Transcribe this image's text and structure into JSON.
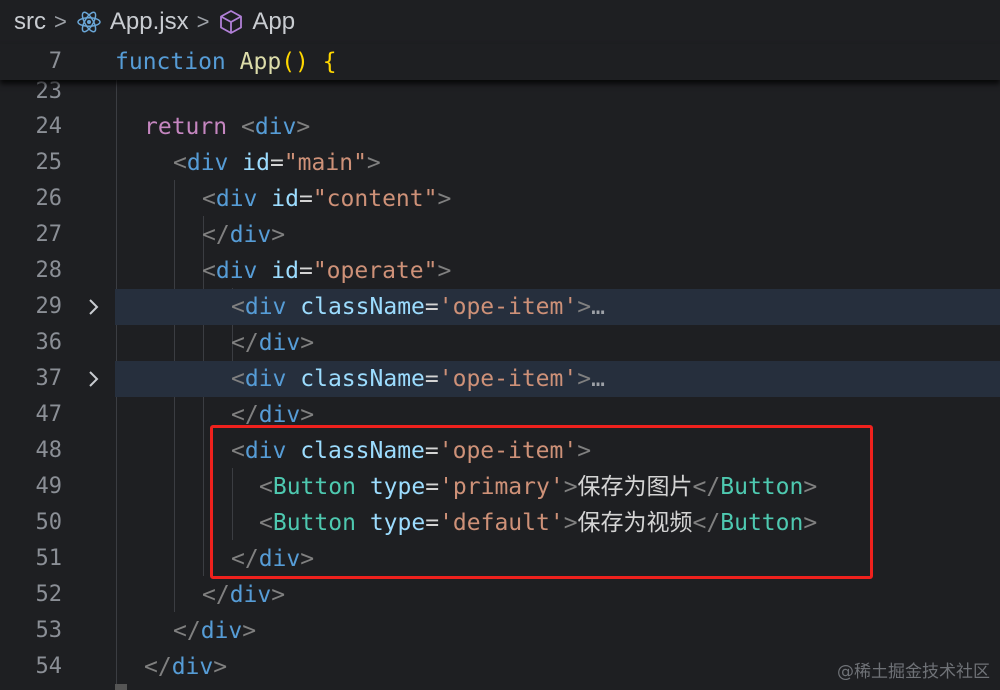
{
  "breadcrumb": {
    "folder": "src",
    "file": "App.jsx",
    "symbol": "App"
  },
  "sticky_line": {
    "number": "7",
    "keyword": "function",
    "name": "App",
    "parens": "()",
    "brace": "{"
  },
  "lines": [
    {
      "n": "23"
    },
    {
      "n": "24"
    },
    {
      "n": "25"
    },
    {
      "n": "26"
    },
    {
      "n": "27"
    },
    {
      "n": "28"
    },
    {
      "n": "29"
    },
    {
      "n": "36"
    },
    {
      "n": "37"
    },
    {
      "n": "47"
    },
    {
      "n": "48"
    },
    {
      "n": "49"
    },
    {
      "n": "50"
    },
    {
      "n": "51"
    },
    {
      "n": "52"
    },
    {
      "n": "53"
    },
    {
      "n": "54"
    }
  ],
  "code": {
    "return_kw": "return",
    "div": "div",
    "id_attr": "id",
    "class_attr": "className",
    "type_attr": "type",
    "main_val": "\"main\"",
    "content_val": "\"content\"",
    "operate_val": "\"operate\"",
    "ope_item_val": "'ope-item'",
    "primary_val": "'primary'",
    "default_val": "'default'",
    "button": "Button",
    "save_image": "保存为图片",
    "save_video": "保存为视频",
    "ellipsis": "…"
  },
  "colors": {
    "highlight_box": "#f0211d",
    "folded_line_bg": "#262f3d",
    "react_icon": "#6aa6d6",
    "symbol_icon": "#b180d7"
  },
  "watermark": "@稀土掘金技术社区"
}
